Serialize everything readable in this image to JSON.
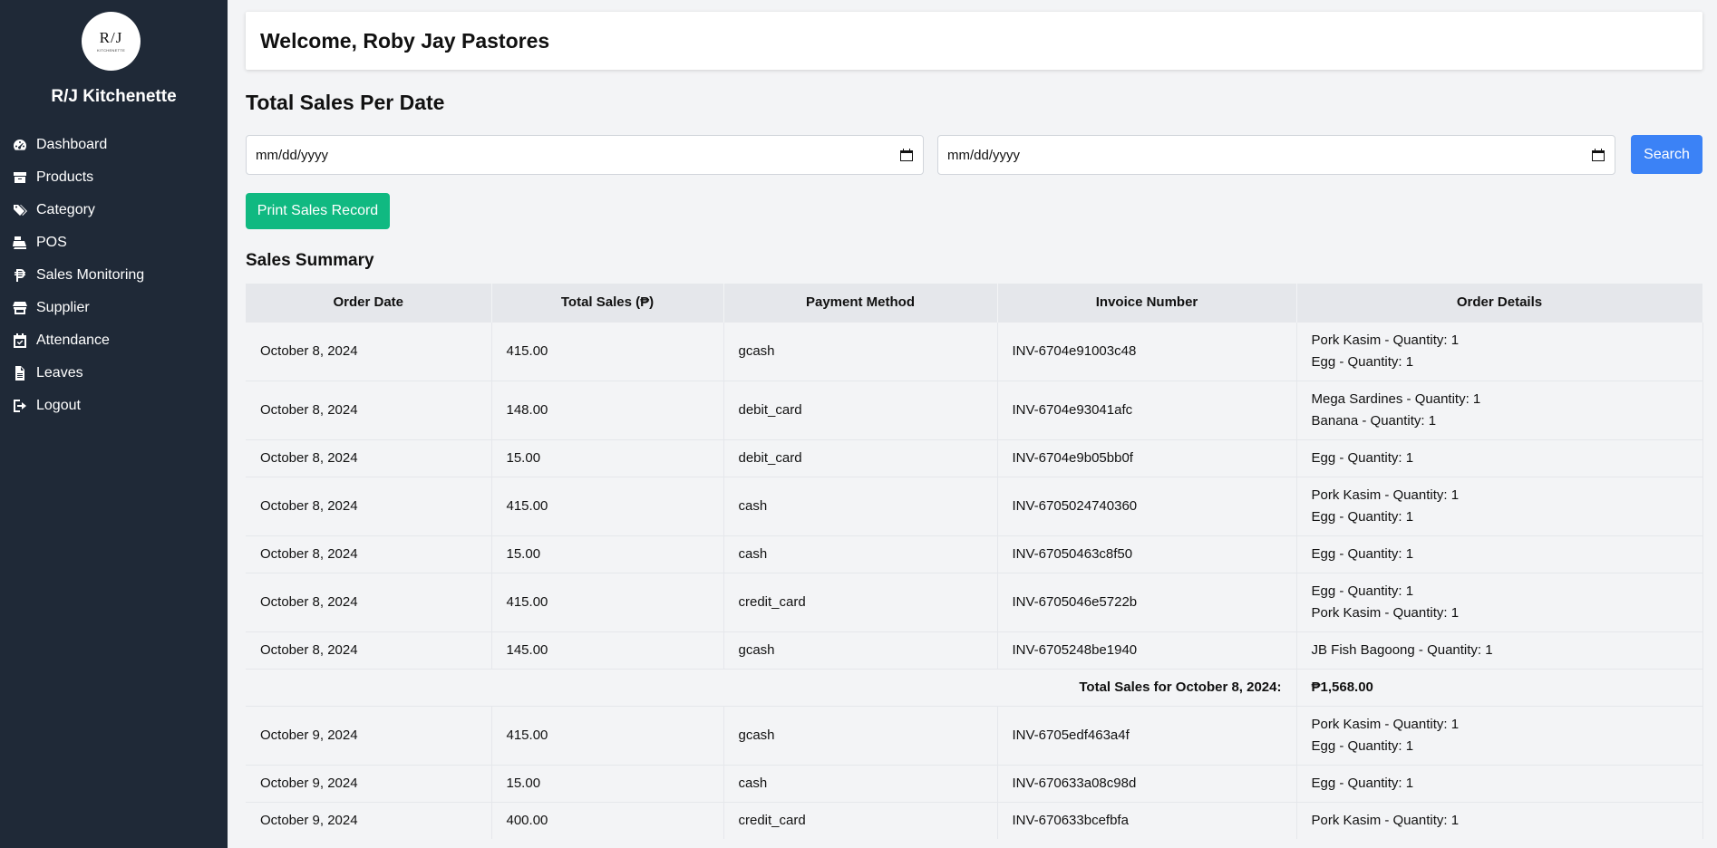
{
  "sidebar": {
    "logo_text": "R/J",
    "logo_sub": "KITCHENETTE",
    "brand": "R/J Kitchenette",
    "items": [
      {
        "label": "Dashboard",
        "icon": "dashboard-icon"
      },
      {
        "label": "Products",
        "icon": "box-icon"
      },
      {
        "label": "Category",
        "icon": "tags-icon"
      },
      {
        "label": "POS",
        "icon": "cash-register-icon"
      },
      {
        "label": "Sales Monitoring",
        "icon": "peso-icon"
      },
      {
        "label": "Supplier",
        "icon": "store-icon"
      },
      {
        "label": "Attendance",
        "icon": "calendar-check-icon"
      },
      {
        "label": "Leaves",
        "icon": "file-icon"
      },
      {
        "label": "Logout",
        "icon": "logout-icon"
      }
    ]
  },
  "header": {
    "welcome": "Welcome, Roby Jay Pastores"
  },
  "page": {
    "title": "Total Sales Per Date"
  },
  "filters": {
    "start_date_placeholder": "mm/dd/yyyy",
    "end_date_placeholder": "mm/dd/yyyy",
    "search_label": "Search"
  },
  "actions": {
    "print_label": "Print Sales Record"
  },
  "summary": {
    "title": "Sales Summary",
    "columns": [
      "Order Date",
      "Total Sales (₱)",
      "Payment Method",
      "Invoice Number",
      "Order Details"
    ],
    "rows": [
      {
        "date": "October 8, 2024",
        "total": "415.00",
        "method": "gcash",
        "invoice": "INV-6704e91003c48",
        "details": [
          "Pork Kasim - Quantity: 1",
          "Egg - Quantity: 1"
        ]
      },
      {
        "date": "October 8, 2024",
        "total": "148.00",
        "method": "debit_card",
        "invoice": "INV-6704e93041afc",
        "details": [
          "Mega Sardines - Quantity: 1",
          "Banana - Quantity: 1"
        ]
      },
      {
        "date": "October 8, 2024",
        "total": "15.00",
        "method": "debit_card",
        "invoice": "INV-6704e9b05bb0f",
        "details": [
          "Egg - Quantity: 1"
        ]
      },
      {
        "date": "October 8, 2024",
        "total": "415.00",
        "method": "cash",
        "invoice": "INV-6705024740360",
        "details": [
          "Pork Kasim - Quantity: 1",
          "Egg - Quantity: 1"
        ]
      },
      {
        "date": "October 8, 2024",
        "total": "15.00",
        "method": "cash",
        "invoice": "INV-67050463c8f50",
        "details": [
          "Egg - Quantity: 1"
        ]
      },
      {
        "date": "October 8, 2024",
        "total": "415.00",
        "method": "credit_card",
        "invoice": "INV-6705046e5722b",
        "details": [
          "Egg - Quantity: 1",
          "Pork Kasim - Quantity: 1"
        ]
      },
      {
        "date": "October 8, 2024",
        "total": "145.00",
        "method": "gcash",
        "invoice": "INV-6705248be1940",
        "details": [
          "JB Fish Bagoong - Quantity: 1"
        ]
      },
      {
        "subtotal": true,
        "label": "Total Sales for October 8, 2024:",
        "amount": "₱1,568.00"
      },
      {
        "date": "October 9, 2024",
        "total": "415.00",
        "method": "gcash",
        "invoice": "INV-6705edf463a4f",
        "details": [
          "Pork Kasim - Quantity: 1",
          "Egg - Quantity: 1"
        ]
      },
      {
        "date": "October 9, 2024",
        "total": "15.00",
        "method": "cash",
        "invoice": "INV-670633a08c98d",
        "details": [
          "Egg - Quantity: 1"
        ]
      },
      {
        "date": "October 9, 2024",
        "total": "400.00",
        "method": "credit_card",
        "invoice": "INV-670633bcefbfa",
        "details": [
          "Pork Kasim - Quantity: 1"
        ]
      }
    ]
  }
}
